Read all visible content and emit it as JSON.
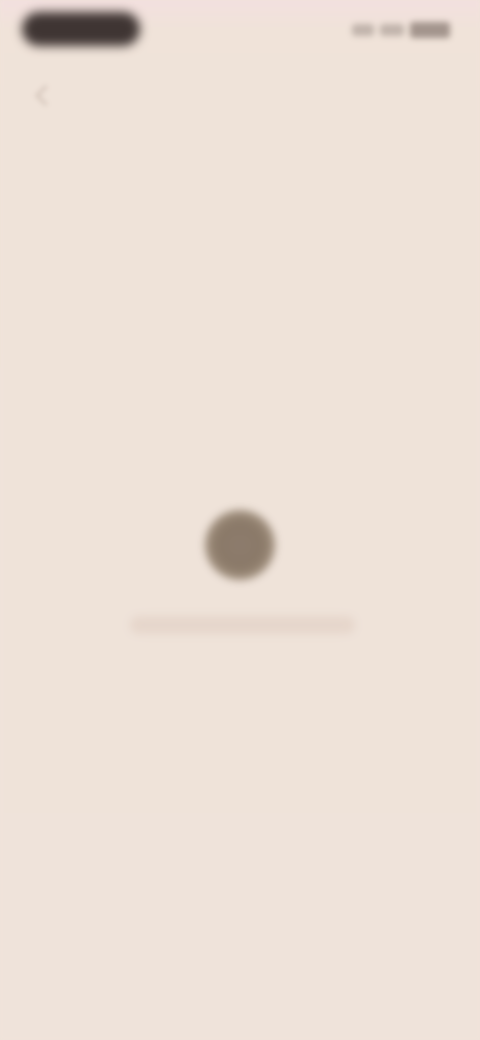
{
  "status_bar": {
    "pill_text": "",
    "icons": [
      "wifi-icon",
      "signal-icon",
      "battery-icon"
    ]
  },
  "navigation": {
    "back_icon": "chevron-left-icon"
  },
  "loading": {
    "spinner_icon": "loading-spinner-icon",
    "message": ""
  },
  "colors": {
    "background": "#efe3d9",
    "status_pill": "#3f3533",
    "spinner": "#8a7968",
    "text_bar": "#e6d6cb"
  }
}
